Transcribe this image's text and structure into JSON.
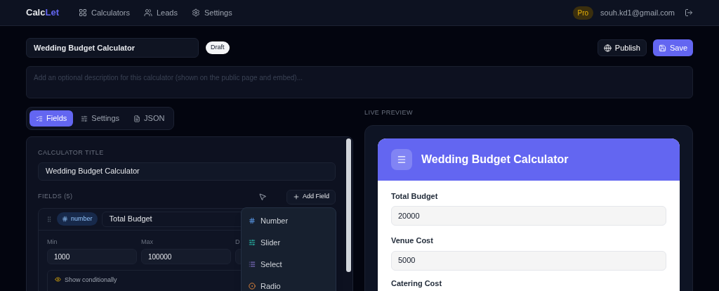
{
  "nav": {
    "logo_start": "Calc",
    "logo_end": "Let",
    "links": [
      {
        "kind": "calculators",
        "label": "Calculators"
      },
      {
        "kind": "leads",
        "label": "Leads"
      },
      {
        "kind": "settings",
        "label": "Settings"
      }
    ],
    "plan_badge": "Pro",
    "email": "souh.kd1@gmail.com"
  },
  "header": {
    "title_value": "Wedding Budget Calculator",
    "status_badge": "Draft",
    "buttons": [
      {
        "kind": "publish",
        "label": "Publish"
      },
      {
        "kind": "save",
        "label": "Save"
      }
    ],
    "description_placeholder": "Add an optional description for this calculator (shown on the public page and embed)..."
  },
  "tabs": [
    {
      "kind": "fields",
      "label": "Fields",
      "selected": true
    },
    {
      "kind": "settings",
      "label": "Settings",
      "selected": false
    },
    {
      "kind": "json",
      "label": "JSON",
      "selected": false
    }
  ],
  "editor": {
    "title_label": "CALCULATOR TITLE",
    "title_value": "Wedding Budget Calculator",
    "fields_heading": "FIELDS (5)",
    "add_button": "Add Field",
    "field": {
      "type_badge": "number",
      "name_value": "Total Budget",
      "params": [
        {
          "label": "Min",
          "value": "1000"
        },
        {
          "label": "Max",
          "value": "100000"
        },
        {
          "label": "D"
        }
      ],
      "conditional_label": "Show conditionally"
    },
    "add_menu": [
      {
        "kind": "number",
        "label": "Number"
      },
      {
        "kind": "slider",
        "label": "Slider"
      },
      {
        "kind": "select",
        "label": "Select"
      },
      {
        "kind": "radio",
        "label": "Radio"
      }
    ]
  },
  "preview": {
    "section_label": "LIVE PREVIEW",
    "title": "Wedding Budget Calculator",
    "inputs": [
      {
        "label": "Total Budget",
        "value": "20000"
      },
      {
        "label": "Venue Cost",
        "value": "5000"
      }
    ],
    "next_label": "Catering Cost"
  }
}
